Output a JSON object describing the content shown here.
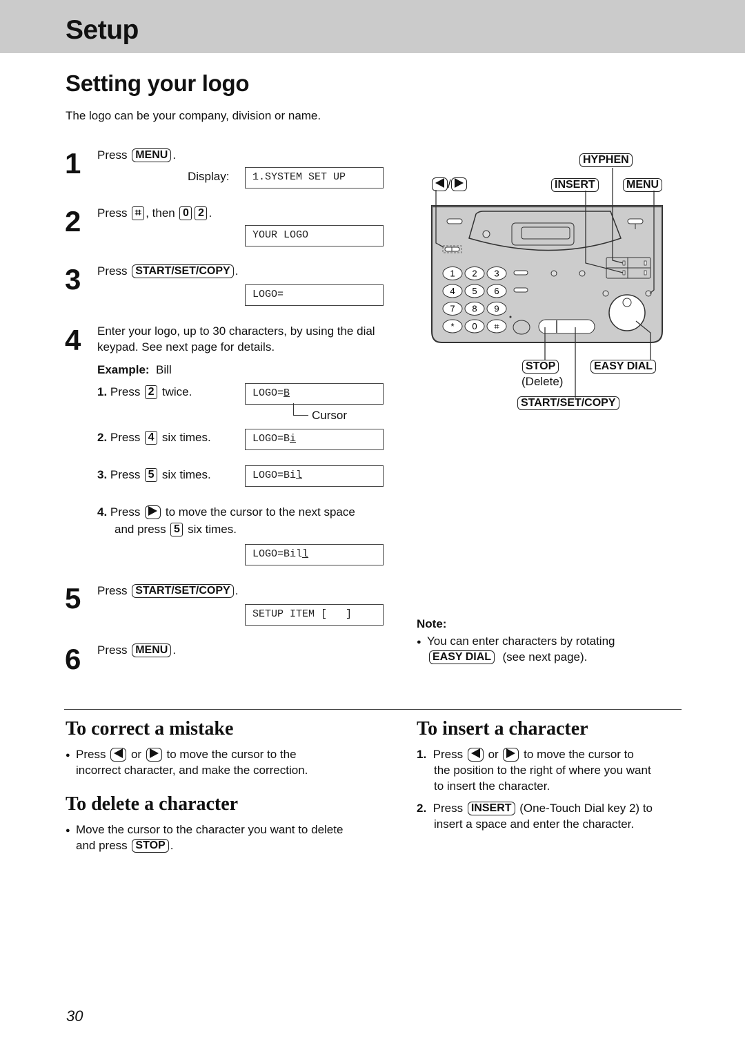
{
  "header": {
    "title": "Setup"
  },
  "page": {
    "title": "Setting your logo",
    "intro": "The logo can be your company, division or name.",
    "page_number": "30"
  },
  "steps": [
    {
      "num": "1",
      "press": "Press",
      "key": "MENU",
      "after": ".",
      "display_label": "Display:",
      "display": "1.SYSTEM SET UP"
    },
    {
      "num": "2",
      "press": "Press",
      "key1": "⌗",
      "mid": ", then",
      "key2": "0",
      "key3": "2",
      "after": ".",
      "display": "YOUR LOGO"
    },
    {
      "num": "3",
      "press": "Press",
      "key": "START/SET/COPY",
      "after": ".",
      "display": "LOGO="
    },
    {
      "num": "4",
      "text": "Enter your logo, up to 30 characters, by using the dial keypad. See next page for details."
    },
    {
      "num": "5",
      "press": "Press",
      "key": "START/SET/COPY",
      "after": ".",
      "display": "SETUP ITEM [   ]"
    },
    {
      "num": "6",
      "press": "Press",
      "key": "MENU",
      "after": "."
    }
  ],
  "example": {
    "label": "Example:",
    "value": "Bill",
    "cursor_label": "Cursor",
    "substeps": [
      {
        "num": "1.",
        "press": "Press",
        "key": "2",
        "after": "twice.",
        "display_prefix": "LOGO=",
        "display_cursor": "B"
      },
      {
        "num": "2.",
        "press": "Press",
        "key": "4",
        "after": "six times.",
        "display_prefix": "LOGO=B",
        "display_cursor": "i"
      },
      {
        "num": "3.",
        "press": "Press",
        "key": "5",
        "after": "six times.",
        "display_prefix": "LOGO=Bi",
        "display_cursor": "l"
      },
      {
        "num": "4.",
        "press": "Press",
        "key_icon": "right-arrow",
        "after": "to move the cursor to the next space",
        "line2_pre": "and press",
        "line2_key": "5",
        "line2_after": "six times.",
        "display_prefix": "LOGO=Bil",
        "display_cursor": "l"
      }
    ]
  },
  "diagram": {
    "labels": {
      "arrows_sep": "/",
      "hyphen": "HYPHEN",
      "insert": "INSERT",
      "menu": "MENU",
      "stop": "STOP",
      "delete": "(Delete)",
      "easy_dial": "EASY DIAL",
      "start_set_copy": "START/SET/COPY"
    },
    "keypad": [
      "1",
      "2",
      "3",
      "4",
      "5",
      "6",
      "7",
      "8",
      "9",
      "*",
      "0",
      "⌗"
    ]
  },
  "note": {
    "title": "Note:",
    "text_pre": "You can enter characters by rotating",
    "key": "EASY DIAL",
    "text_post": "(see next page)."
  },
  "correct": {
    "title": "To correct a mistake",
    "pre": "Press",
    "or": "or",
    "post": "to move the cursor to the",
    "line2": "incorrect character, and make the correction."
  },
  "delete": {
    "title": "To delete a character",
    "line1": "Move the cursor to the character you want to delete",
    "line2_pre": "and press",
    "key": "STOP",
    "line2_post": "."
  },
  "insert": {
    "title": "To insert a character",
    "items": [
      {
        "num": "1.",
        "pre": "Press",
        "or": "or",
        "post": "to move the cursor to",
        "line2": "the position to the right of where you want",
        "line3": "to insert the character."
      },
      {
        "num": "2.",
        "pre": "Press",
        "key": "INSERT",
        "post": "(One-Touch Dial key 2) to",
        "line2": "insert a space and enter the character."
      }
    ]
  }
}
